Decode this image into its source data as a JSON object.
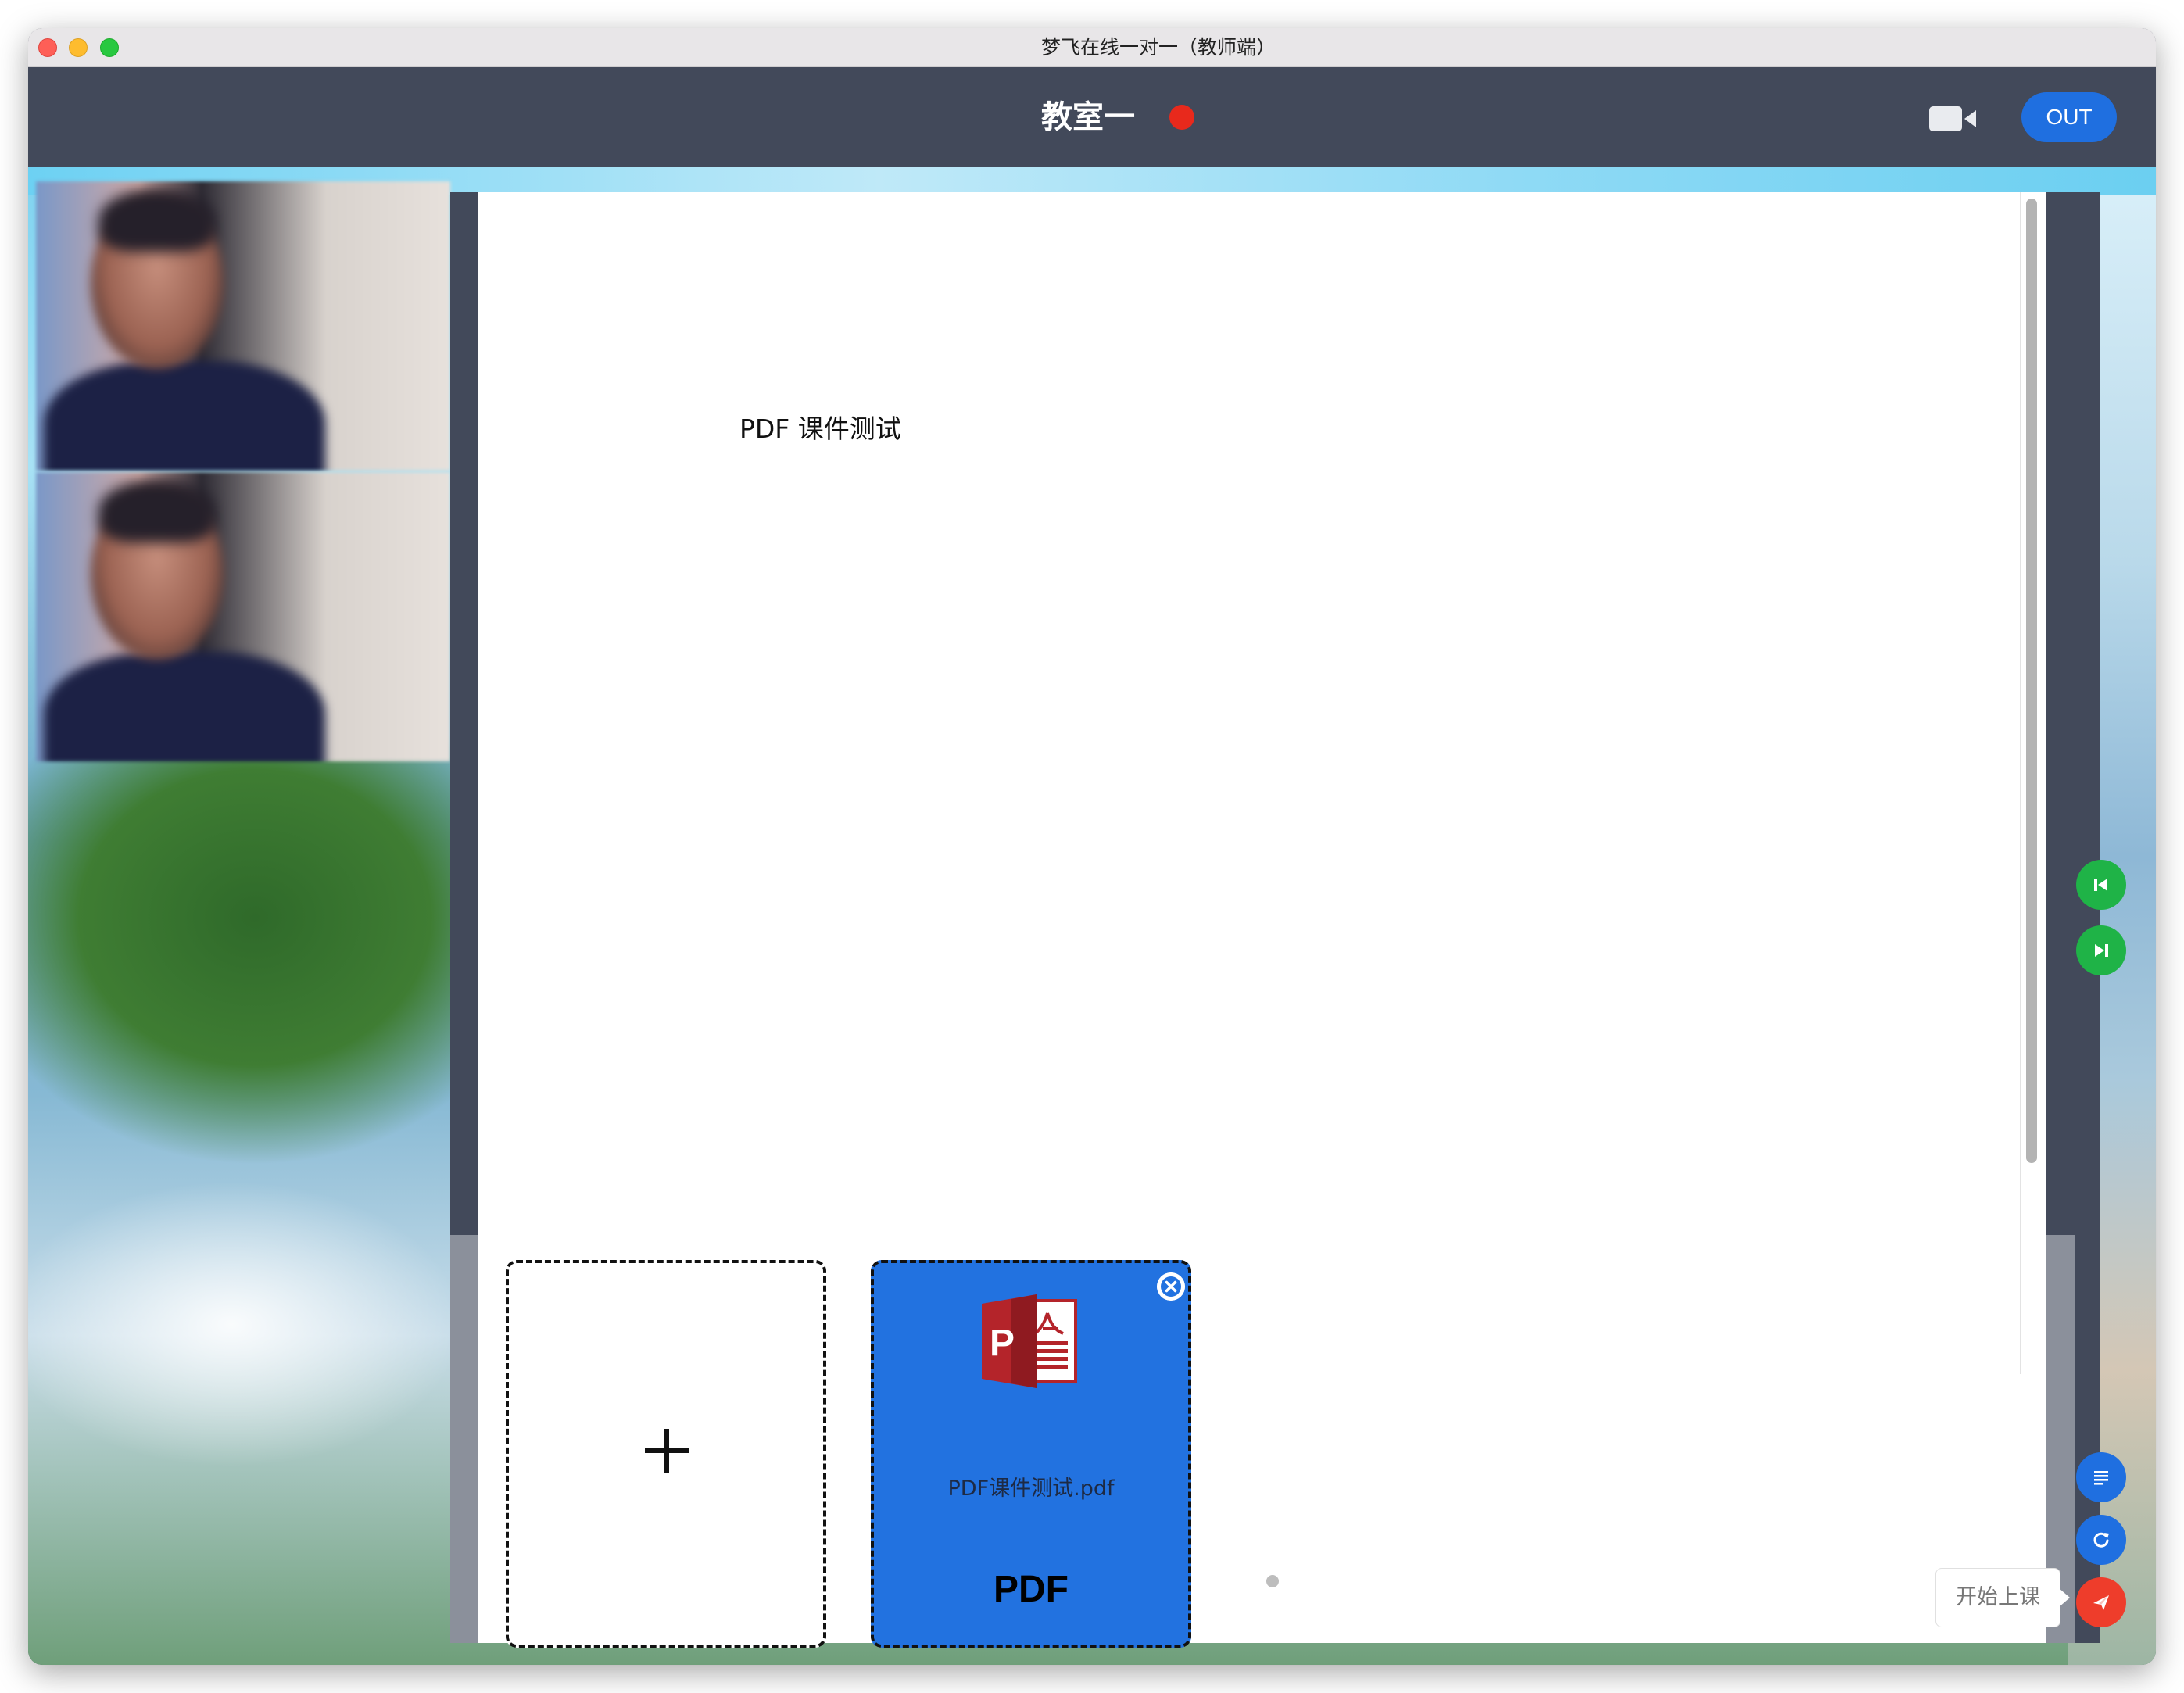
{
  "window": {
    "title": "梦飞在线一对一（教师端）"
  },
  "header": {
    "room_name": "教室一",
    "recording_color": "#e8291c",
    "camera_icon": "video-camera-icon",
    "out_label": "OUT"
  },
  "board": {
    "title": "PDF 课件测试"
  },
  "files": [
    {
      "kind": "upload",
      "icon": "plus-icon"
    },
    {
      "kind": "pdf",
      "name": "PDF课件测试.pdf",
      "type": "PDF",
      "icon": "pdf-file-icon",
      "close_icon": "close-icon"
    }
  ],
  "controls": {
    "prev_page_icon": "skip-previous-icon",
    "next_page_icon": "skip-next-icon",
    "list_icon": "list-icon",
    "refresh_icon": "refresh-icon",
    "send_icon": "paper-plane-icon",
    "start_class_tooltip": "开始上课"
  },
  "colors": {
    "accent_blue": "#1f6fe0",
    "nav_green": "#1fb347",
    "send_red": "#ee3d2b",
    "header_bg": "#42495a"
  }
}
